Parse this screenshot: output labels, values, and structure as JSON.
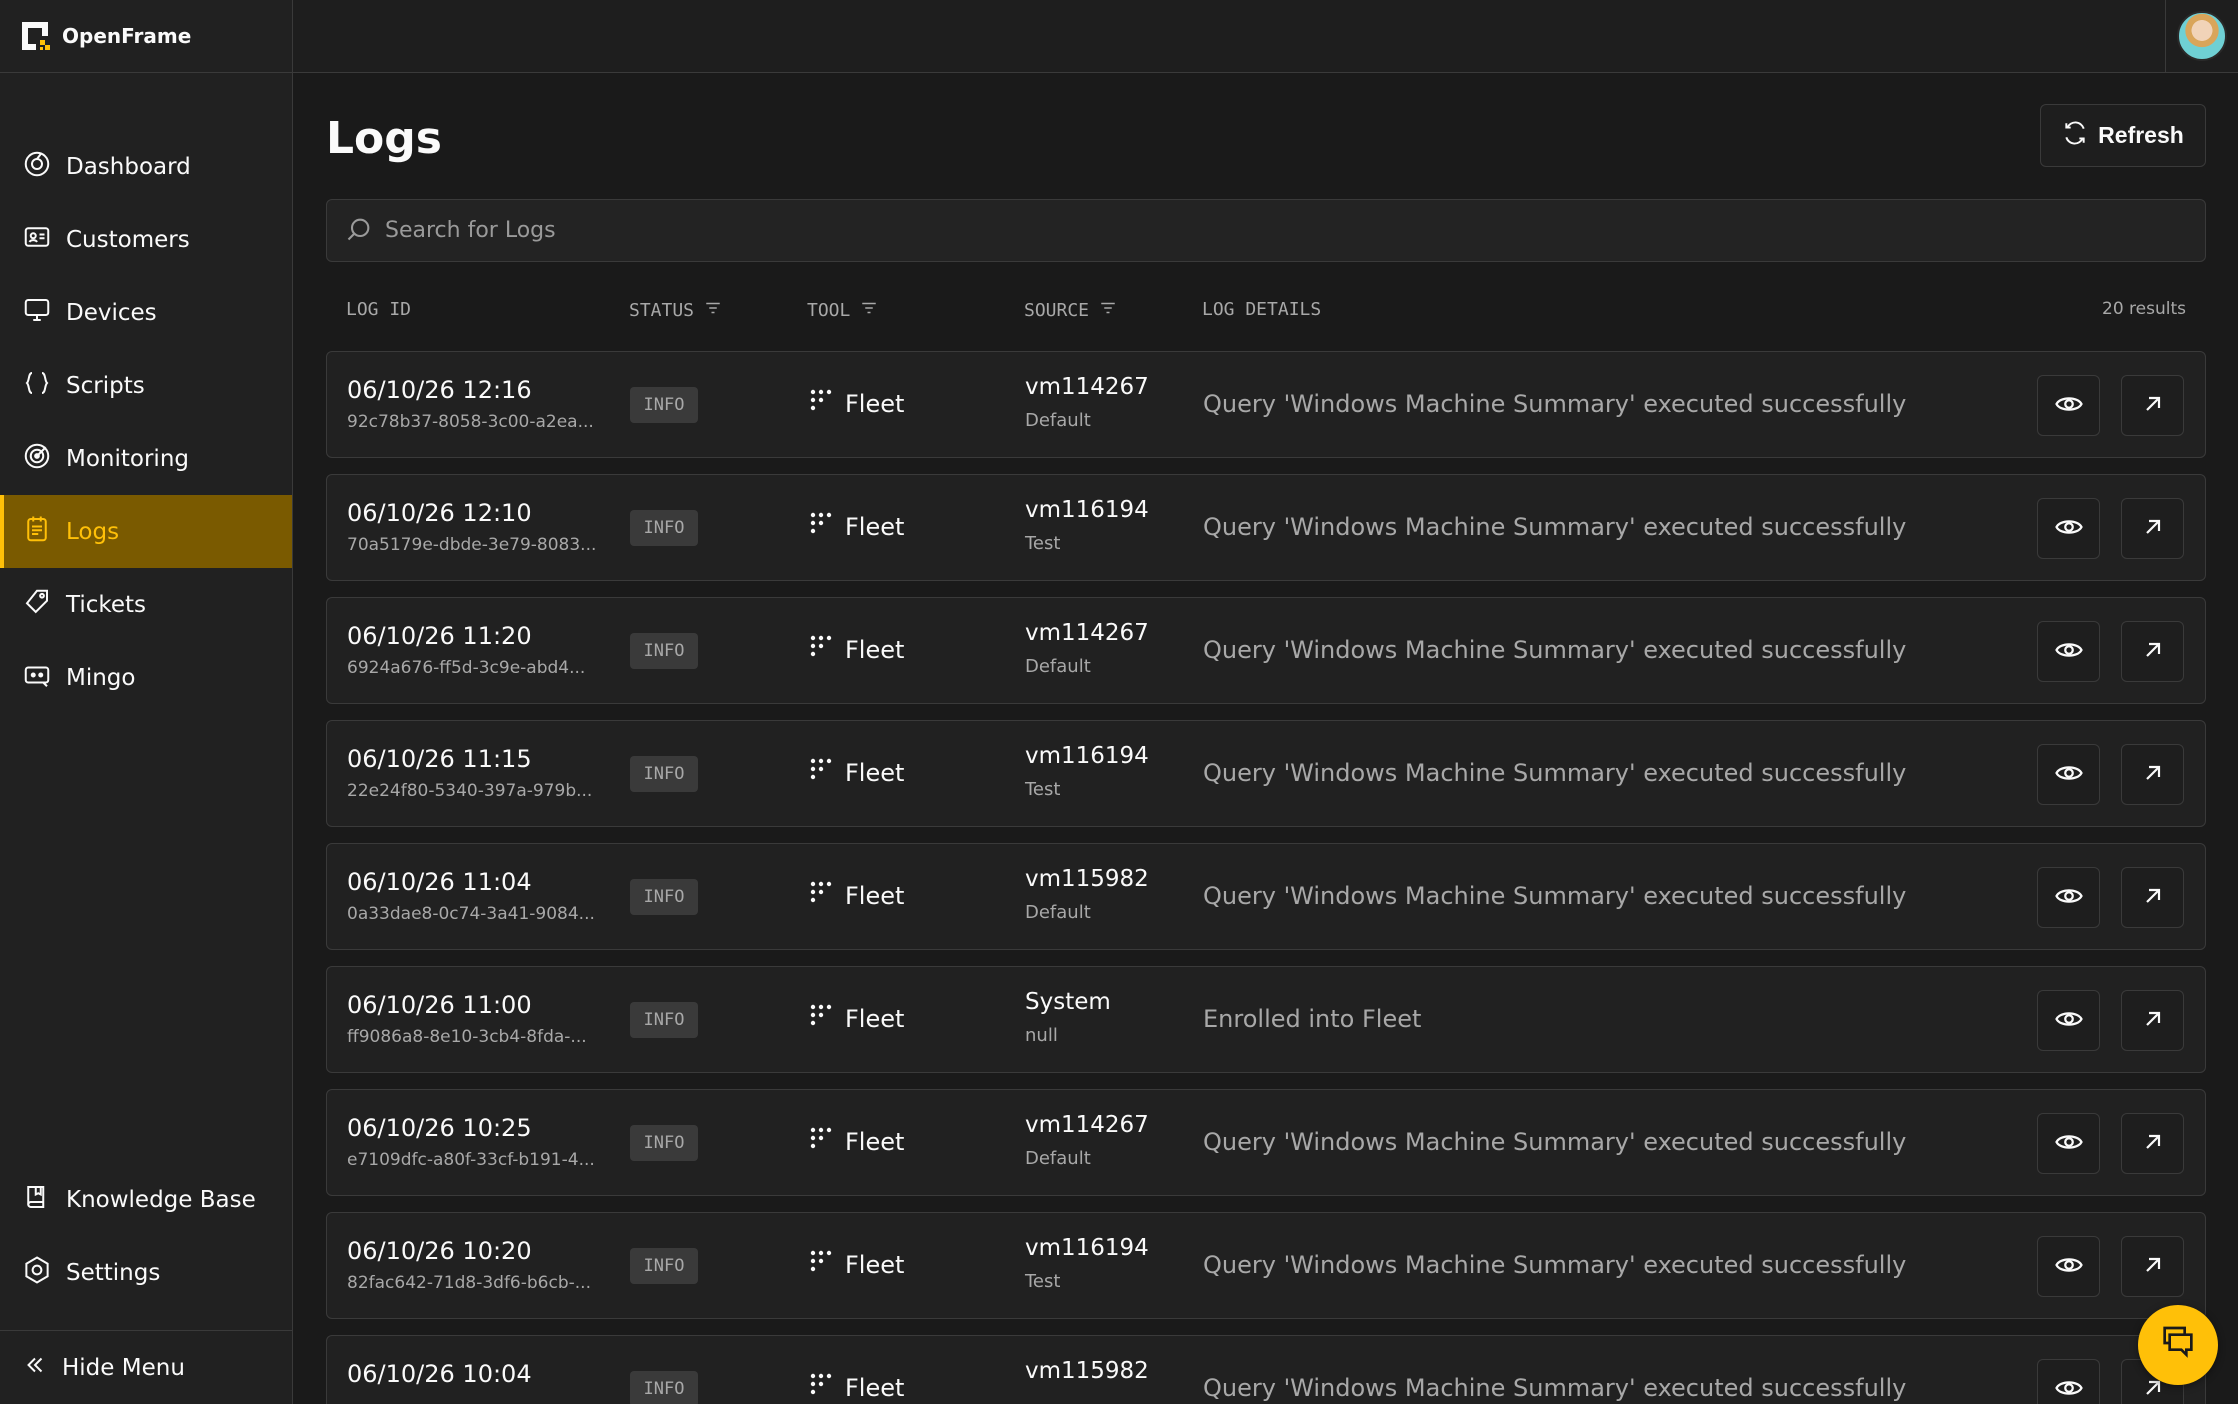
{
  "app": {
    "name": "OpenFrame"
  },
  "nav": {
    "items": [
      {
        "label": "Dashboard",
        "icon": "dashboard-icon"
      },
      {
        "label": "Customers",
        "icon": "customers-icon"
      },
      {
        "label": "Devices",
        "icon": "devices-icon"
      },
      {
        "label": "Scripts",
        "icon": "scripts-icon"
      },
      {
        "label": "Monitoring",
        "icon": "monitoring-icon"
      },
      {
        "label": "Logs",
        "icon": "logs-icon",
        "active": true
      },
      {
        "label": "Tickets",
        "icon": "tickets-icon"
      },
      {
        "label": "Mingo",
        "icon": "mingo-icon"
      }
    ],
    "bottom": [
      {
        "label": "Knowledge Base",
        "icon": "knowledge-base-icon"
      },
      {
        "label": "Settings",
        "icon": "settings-icon"
      }
    ],
    "hide_menu": "Hide Menu"
  },
  "page": {
    "title": "Logs",
    "refresh_label": "Refresh"
  },
  "search": {
    "placeholder": "Search for Logs"
  },
  "table": {
    "headers": {
      "log_id": "LOG ID",
      "status": "STATUS",
      "tool": "TOOL",
      "source": "SOURCE",
      "log_details": "LOG DETAILS"
    },
    "results": "20 results",
    "rows": [
      {
        "date": "06/10/26 12:16",
        "uuid": "92c78b37-8058-3c00-a2ea...",
        "status": "INFO",
        "tool": "Fleet",
        "source": "vm114267",
        "source_sub": "Default",
        "details": "Query 'Windows Machine Summary' executed successfully"
      },
      {
        "date": "06/10/26 12:10",
        "uuid": "70a5179e-dbde-3e79-8083...",
        "status": "INFO",
        "tool": "Fleet",
        "source": "vm116194",
        "source_sub": "Test",
        "details": "Query 'Windows Machine Summary' executed successfully"
      },
      {
        "date": "06/10/26 11:20",
        "uuid": "6924a676-ff5d-3c9e-abd4...",
        "status": "INFO",
        "tool": "Fleet",
        "source": "vm114267",
        "source_sub": "Default",
        "details": "Query 'Windows Machine Summary' executed successfully"
      },
      {
        "date": "06/10/26 11:15",
        "uuid": "22e24f80-5340-397a-979b...",
        "status": "INFO",
        "tool": "Fleet",
        "source": "vm116194",
        "source_sub": "Test",
        "details": "Query 'Windows Machine Summary' executed successfully"
      },
      {
        "date": "06/10/26 11:04",
        "uuid": "0a33dae8-0c74-3a41-9084...",
        "status": "INFO",
        "tool": "Fleet",
        "source": "vm115982",
        "source_sub": "Default",
        "details": "Query 'Windows Machine Summary' executed successfully"
      },
      {
        "date": "06/10/26 11:00",
        "uuid": "ff9086a8-8e10-3cb4-8fda-...",
        "status": "INFO",
        "tool": "Fleet",
        "source": "System",
        "source_sub": "null",
        "details": "Enrolled into Fleet"
      },
      {
        "date": "06/10/26 10:25",
        "uuid": "e7109dfc-a80f-33cf-b191-4...",
        "status": "INFO",
        "tool": "Fleet",
        "source": "vm114267",
        "source_sub": "Default",
        "details": "Query 'Windows Machine Summary' executed successfully"
      },
      {
        "date": "06/10/26 10:20",
        "uuid": "82fac642-71d8-3df6-b6cb-...",
        "status": "INFO",
        "tool": "Fleet",
        "source": "vm116194",
        "source_sub": "Test",
        "details": "Query 'Windows Machine Summary' executed successfully"
      },
      {
        "date": "06/10/26 10:04",
        "uuid": "",
        "status": "INFO",
        "tool": "Fleet",
        "source": "vm115982",
        "source_sub": "",
        "details": "Query 'Windows Machine Summary' executed successfully"
      }
    ]
  },
  "colors": {
    "accent": "#ffc008",
    "active_bg": "#7a5a00",
    "background": "#1a1a1a",
    "panel": "#212121",
    "border": "#3a3a3a"
  }
}
